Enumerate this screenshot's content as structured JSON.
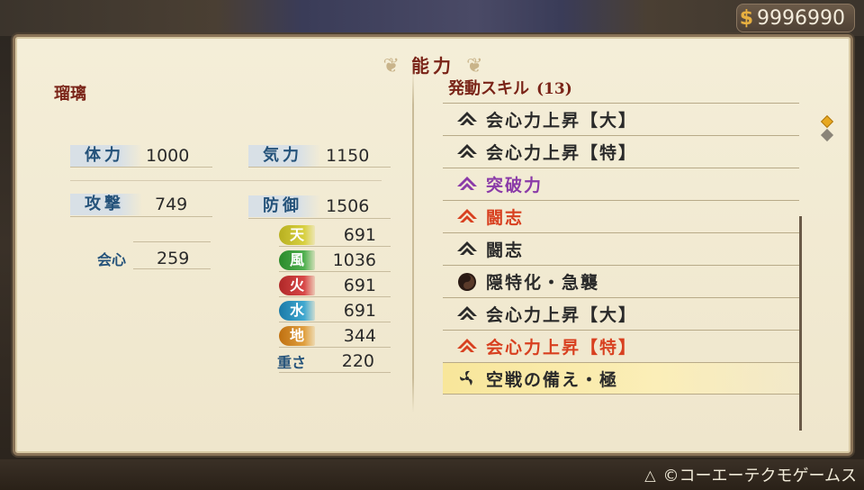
{
  "currency": {
    "icon": "coin-icon",
    "amount": "9996990"
  },
  "title": "能力",
  "character": {
    "name": "瑠璃"
  },
  "stats": {
    "hp": {
      "label": "体力",
      "value": "1000"
    },
    "ki": {
      "label": "気力",
      "value": "1150"
    },
    "attack": {
      "label": "攻撃",
      "value": "749"
    },
    "defense": {
      "label": "防御",
      "value": "1506"
    },
    "critical": {
      "label": "会心",
      "value": "259"
    },
    "weight": {
      "label": "重さ",
      "value": "220"
    }
  },
  "elements": [
    {
      "label": "天",
      "value": "691",
      "color": "#b8b020"
    },
    {
      "label": "風",
      "value": "1036",
      "color": "#3a9a3a"
    },
    {
      "label": "火",
      "value": "691",
      "color": "#c03030"
    },
    {
      "label": "水",
      "value": "691",
      "color": "#2a8ab8"
    },
    {
      "label": "地",
      "value": "344",
      "color": "#c8801c"
    }
  ],
  "skills": {
    "header": "発動スキル",
    "count": "(13)",
    "items": [
      {
        "name": "会心力上昇【大】",
        "color": "#2a2a2a",
        "icon": "chevron-icon"
      },
      {
        "name": "会心力上昇【特】",
        "color": "#2a2a2a",
        "icon": "chevron-icon"
      },
      {
        "name": "突破力",
        "color": "#8a3aa8",
        "icon": "chevron-icon"
      },
      {
        "name": "闘志",
        "color": "#d84020",
        "icon": "chevron-icon"
      },
      {
        "name": "闘志",
        "color": "#2a2a2a",
        "icon": "chevron-icon"
      },
      {
        "name": "隠特化・急襲",
        "color": "#2a2a2a",
        "icon": "swirl-icon"
      },
      {
        "name": "会心力上昇【大】",
        "color": "#2a2a2a",
        "icon": "chevron-icon"
      },
      {
        "name": "会心力上昇【特】",
        "color": "#d84020",
        "icon": "chevron-icon"
      },
      {
        "name": "空戦の備え・極",
        "color": "#2a2a2a",
        "icon": "triskelion-icon"
      }
    ]
  },
  "footer": {
    "button_icon": "triangle-button-icon",
    "text": "©コーエーテクモゲームス"
  }
}
